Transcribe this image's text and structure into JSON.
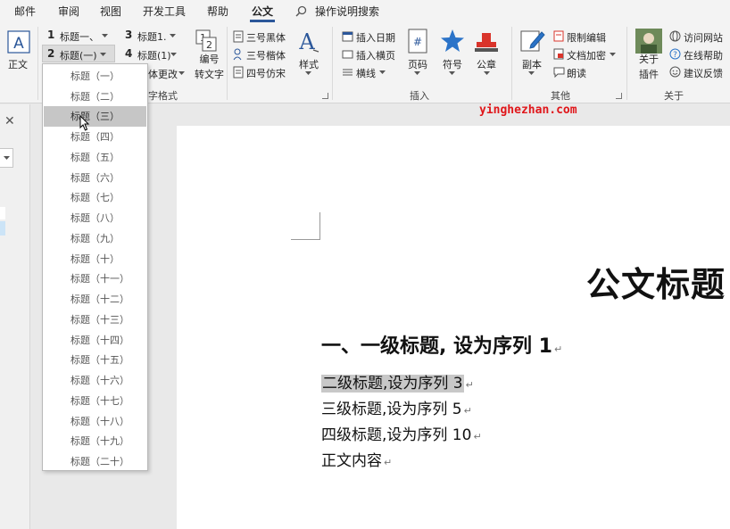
{
  "menu": {
    "tabs": [
      "邮件",
      "审阅",
      "视图",
      "开发工具",
      "帮助",
      "公文"
    ],
    "search_label": "操作说明搜索"
  },
  "ribbon": {
    "zhengwen": "正文",
    "heading_style_1": "标题一、",
    "heading_style_2": "标题(一)",
    "heading_style_3": "标题1.",
    "heading_style_4": "标题(1)",
    "num_1": "1",
    "num_2": "2",
    "num_3": "3",
    "num_4": "4",
    "biaohao_label": "编号转文字",
    "batch_change": "体更改",
    "font_group_label": "字格式",
    "font_heiti": "三号黑体",
    "font_kaiti": "三号楷体",
    "font_fangsong": "四号仿宋",
    "style_label": "样式",
    "insert_date": "插入日期",
    "insert_hengye": "插入横页",
    "hengxian": "横线",
    "page_num": "页码",
    "symbol": "符号",
    "seal": "公章",
    "insert_group_label": "插入",
    "copy_label": "副本",
    "restrict_edit": "限制编辑",
    "doc_encrypt": "文档加密",
    "read_aloud": "朗读",
    "other_group_label": "其他",
    "about_plugin": "关于插件",
    "visit_site": "访问网站",
    "online_help": "在线帮助",
    "feedback": "建议反馈",
    "about_group_label": "关于"
  },
  "dropdown": {
    "items": [
      "标题（一）",
      "标题（二）",
      "标题（三）",
      "标题（四）",
      "标题（五）",
      "标题（六）",
      "标题（七）",
      "标题（八）",
      "标题（九）",
      "标题（十）",
      "标题（十一）",
      "标题（十二）",
      "标题（十三）",
      "标题（十四）",
      "标题（十五）",
      "标题（十六）",
      "标题（十七）",
      "标题（十八）",
      "标题（十九）",
      "标题（二十）"
    ],
    "selected": "标题（三）"
  },
  "document": {
    "title": "公文标题",
    "h1": "一、一级标题, 设为序列 1",
    "lines": [
      "二级标题,设为序列 3",
      "三级标题,设为序列 5",
      "四级标题,设为序列 10",
      "正文内容"
    ],
    "para_mark": "↵"
  },
  "close_symbol": "✕",
  "watermark": "yinghezhan.com",
  "colors": {
    "accent": "#2b579a",
    "star": "#2b73c8",
    "seal": "#d9342b",
    "watermark": "#e0161a"
  }
}
